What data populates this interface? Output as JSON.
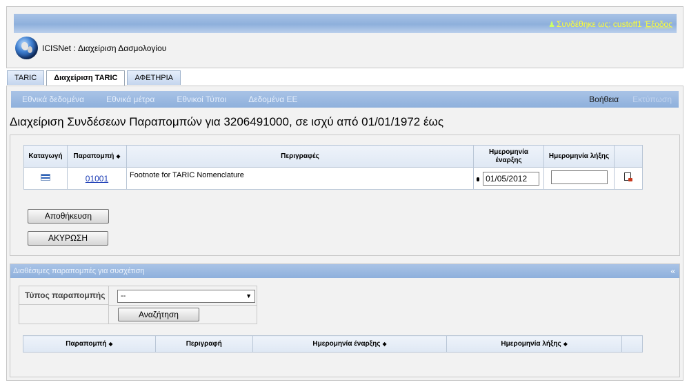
{
  "header": {
    "logged_in_label": "Συνδέθηκε ως: custoff1",
    "logout_label": "Έξοδος",
    "app_title": "ICISNet : Διαχείριση Δασμολογίου"
  },
  "tabs": [
    {
      "label": "TARIC",
      "active": false
    },
    {
      "label": "Διαχείριση TARIC",
      "active": true
    },
    {
      "label": "ΑΦΕΤΗΡΙΑ",
      "active": false
    }
  ],
  "nav": {
    "items": [
      "Εθνικά δεδομένα",
      "Εθνικά μέτρα",
      "Εθνικοί Τύποι",
      "Δεδομένα ΕΕ"
    ],
    "help": "Βοήθεια",
    "print": "Εκτύπωση"
  },
  "page_title": "Διαχείριση Συνδέσεων Παραπομπών για 3206491000, σε ισχύ από 01/01/1972 έως",
  "links_table": {
    "headers": {
      "origin": "Καταγωγή",
      "footnote": "Παραπομπή",
      "descriptions": "Περιγραφές",
      "start_date": "Ημερομηνία έναρξης",
      "end_date": "Ημερομηνία λήξης"
    },
    "rows": [
      {
        "origin_icon": "greek-flag-icon",
        "footnote": "01001",
        "description": "Footnote for TARIC Nomenclature",
        "start_date": "01/05/2012",
        "end_date": ""
      }
    ]
  },
  "buttons": {
    "save": "Αποθήκευση",
    "cancel": "ΑΚΥΡΩΣΗ",
    "search": "Αναζήτηση"
  },
  "available": {
    "title": "Διαθέσιμες παραπομπές για συσχέτιση",
    "collapse": "«",
    "filter_label": "Τύπος παραπομπής",
    "filter_value": "--",
    "headers": {
      "footnote": "Παραπομπή",
      "description": "Περιγραφή",
      "start_date": "Ημερομηνία έναρξης",
      "end_date": "Ημερομηνία λήξης"
    }
  },
  "colors": {
    "bar_blue": "#8eb0dc",
    "user_text": "#ffff33",
    "link": "#1a3bb5"
  }
}
